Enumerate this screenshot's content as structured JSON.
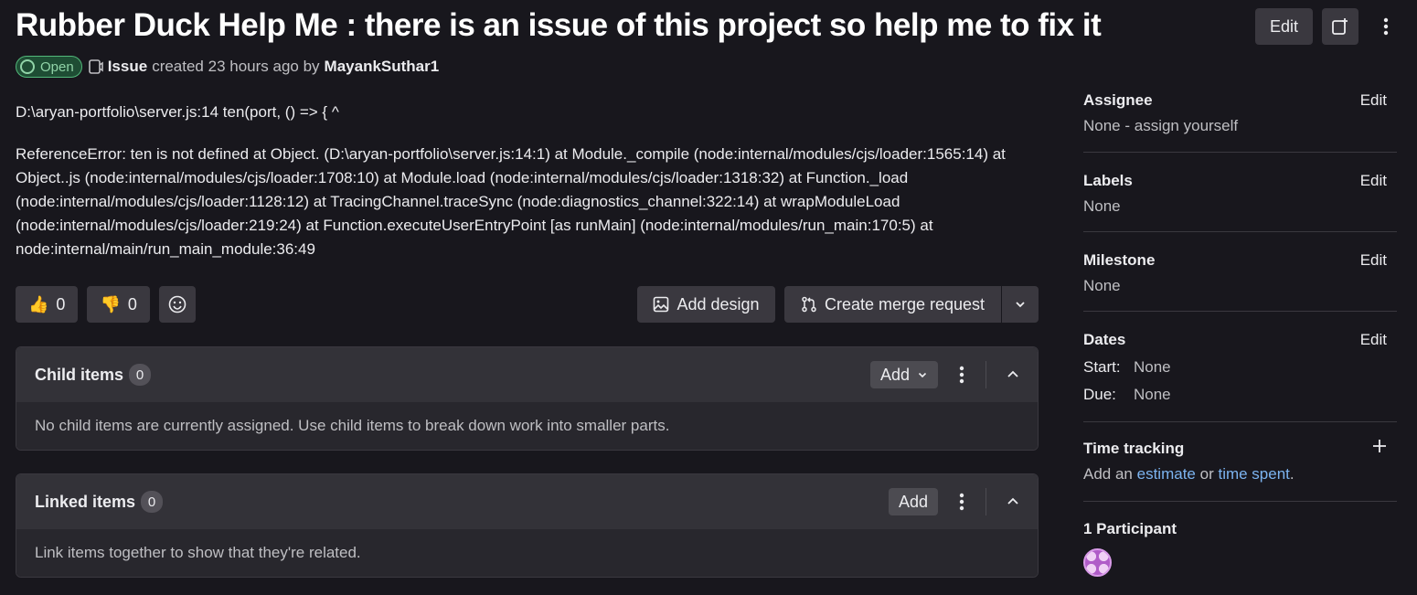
{
  "issue": {
    "title": "Rubber Duck Help Me : there is an issue of this project so help me to fix it",
    "state": "Open",
    "type": "Issue",
    "created_text": "created 23 hours ago by",
    "author": "MayankSuthar1"
  },
  "header": {
    "edit_label": "Edit"
  },
  "description": {
    "line1": "D:\\aryan-portfolio\\server.js:14 ten(port, () => { ^",
    "line2": "ReferenceError: ten is not defined at Object. (D:\\aryan-portfolio\\server.js:14:1) at Module._compile (node:internal/modules/cjs/loader:1565:14) at Object..js (node:internal/modules/cjs/loader:1708:10) at Module.load (node:internal/modules/cjs/loader:1318:32) at Function._load (node:internal/modules/cjs/loader:1128:12) at TracingChannel.traceSync (node:diagnostics_channel:322:14) at wrapModuleLoad (node:internal/modules/cjs/loader:219:24) at Function.executeUserEntryPoint [as runMain] (node:internal/modules/run_main:170:5) at node:internal/main/run_main_module:36:49"
  },
  "reactions": {
    "thumbs_up": "0",
    "thumbs_down": "0"
  },
  "actions": {
    "add_design": "Add design",
    "create_merge_request": "Create merge request"
  },
  "child_items": {
    "title": "Child items",
    "count": "0",
    "add_label": "Add",
    "empty_text": "No child items are currently assigned. Use child items to break down work into smaller parts."
  },
  "linked_items": {
    "title": "Linked items",
    "count": "0",
    "add_label": "Add",
    "empty_text": "Link items together to show that they're related."
  },
  "sidebar": {
    "assignee": {
      "label": "Assignee",
      "edit": "Edit",
      "value": "None - assign yourself"
    },
    "labels": {
      "label": "Labels",
      "edit": "Edit",
      "value": "None"
    },
    "milestone": {
      "label": "Milestone",
      "edit": "Edit",
      "value": "None"
    },
    "dates": {
      "label": "Dates",
      "edit": "Edit",
      "start_label": "Start:",
      "start_value": "None",
      "due_label": "Due:",
      "due_value": "None"
    },
    "time_tracking": {
      "label": "Time tracking",
      "prefix": "Add an",
      "estimate": "estimate",
      "or": "or",
      "time_spent": "time spent",
      "suffix": "."
    },
    "participants": {
      "label": "1 Participant"
    }
  },
  "colors": {
    "background": "#18171d",
    "open_badge": "#52b87a",
    "link": "#7cb4f0"
  }
}
